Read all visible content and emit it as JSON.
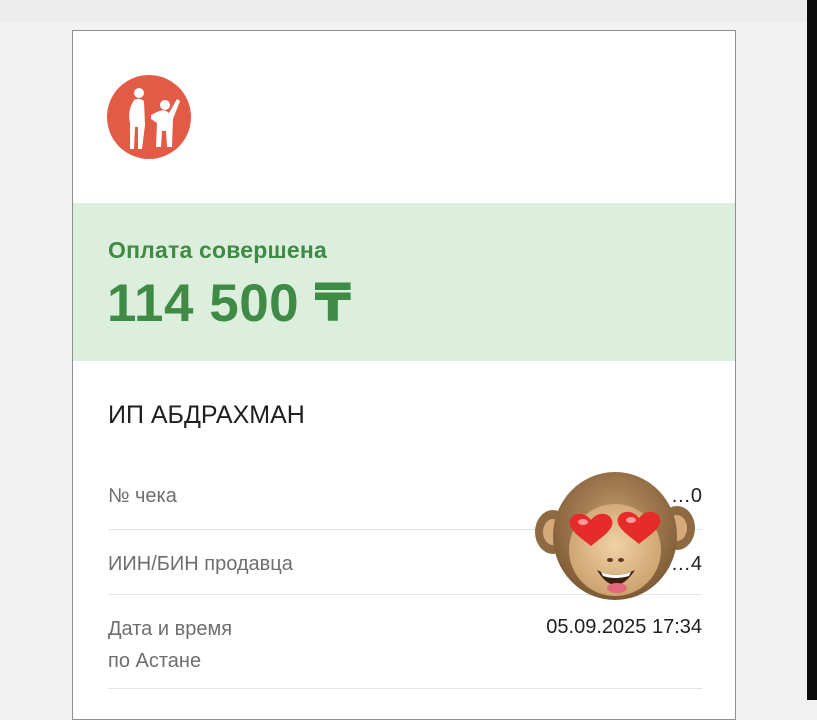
{
  "colors": {
    "brand": "#e35a47",
    "success_bg": "#dcefdd",
    "success_text": "#3f8a45"
  },
  "receipt": {
    "logo_icon": "bank-logo-two-people",
    "status": "Оплата совершена",
    "amount": "114 500 ₸",
    "merchant": "ИП АБДРАХМАН",
    "fields": [
      {
        "label": "№ чека",
        "value": "…0"
      },
      {
        "label": "ИИН/БИН продавца",
        "value": "9…4"
      },
      {
        "label_line1": "Дата и время",
        "label_line2": "по Астане",
        "value": "05.09.2025 17:34"
      }
    ]
  },
  "overlay": {
    "sticker": "monkey-heart-eyes-emoji"
  }
}
